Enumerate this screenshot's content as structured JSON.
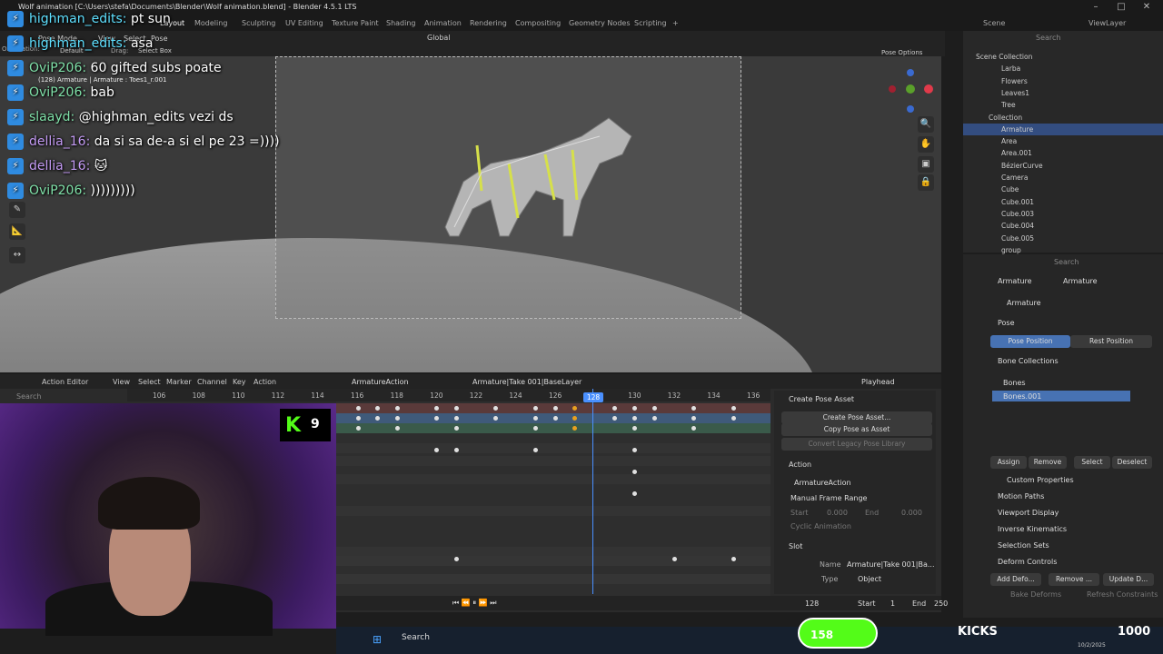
{
  "window": {
    "title": "Wolf animation [C:\\Users\\stefa\\Documents\\Blender\\Wolf animation.blend] - Blender 4.5.1 LTS"
  },
  "workspaces": [
    "Layout",
    "Modeling",
    "Sculpting",
    "UV Editing",
    "Texture Paint",
    "Shading",
    "Animation",
    "Rendering",
    "Compositing",
    "Geometry Nodes",
    "Scripting"
  ],
  "workspace_add": "+",
  "viewport": {
    "mode": "Pose Mode",
    "menus": [
      "View",
      "Select",
      "Pose"
    ],
    "orientation_label": "Orientation:",
    "orientation": "Default",
    "drag_label": "Drag:",
    "drag_value": "Select Box",
    "transform_orientation": "Global",
    "info_line": "(128) Armature | Armature : Toes1_r.001",
    "pose_options": "Pose Options",
    "ult_text": "ult"
  },
  "chat": [
    {
      "user": "highman_edits:",
      "msg": "pt sun",
      "color": "u"
    },
    {
      "user": "highman_edits:",
      "msg": "asa",
      "color": "u"
    },
    {
      "user": "OviP206:",
      "msg": "60 gifted subs poate",
      "color": "u3"
    },
    {
      "user": "OviP206:",
      "msg": "bab",
      "color": "u3"
    },
    {
      "user": "slaayd:",
      "msg": "@highman_edits vezi ds",
      "color": "u3"
    },
    {
      "user": "dellia_16:",
      "msg": "da si sa de-a si el pe 23 =))))",
      "color": "u2"
    },
    {
      "user": "dellia_16:",
      "msg": "🐱",
      "color": "u2"
    },
    {
      "user": "OviP206:",
      "msg": ")))))))))",
      "color": "u3"
    }
  ],
  "chat_badge_count": "1",
  "outliner": {
    "scene": "Scene",
    "view_layer": "ViewLayer",
    "search_placeholder": "Search",
    "rows": [
      {
        "name": "Scene Collection",
        "indent": 0,
        "sel": false
      },
      {
        "name": "Larba",
        "indent": 2,
        "sel": false
      },
      {
        "name": "Flowers",
        "indent": 2,
        "sel": false
      },
      {
        "name": "Leaves1",
        "indent": 2,
        "sel": false
      },
      {
        "name": "Tree",
        "indent": 2,
        "sel": false
      },
      {
        "name": "Collection",
        "indent": 1,
        "sel": false
      },
      {
        "name": "Armature",
        "indent": 2,
        "sel": true
      },
      {
        "name": "Area",
        "indent": 2,
        "sel": false
      },
      {
        "name": "Area.001",
        "indent": 2,
        "sel": false
      },
      {
        "name": "BézierCurve",
        "indent": 2,
        "sel": false
      },
      {
        "name": "Camera",
        "indent": 2,
        "sel": false
      },
      {
        "name": "Cube",
        "indent": 2,
        "sel": false
      },
      {
        "name": "Cube.001",
        "indent": 2,
        "sel": false
      },
      {
        "name": "Cube.003",
        "indent": 2,
        "sel": false
      },
      {
        "name": "Cube.004",
        "indent": 2,
        "sel": false
      },
      {
        "name": "Cube.005",
        "indent": 2,
        "sel": false
      },
      {
        "name": "group",
        "indent": 2,
        "sel": false
      }
    ]
  },
  "properties": {
    "search_placeholder": "Search",
    "breadcrumb": [
      "Armature",
      "Armature"
    ],
    "data_name": "Armature",
    "pose": "Pose",
    "pose_position": "Pose Position",
    "rest_position": "Rest Position",
    "bone_collections": "Bone Collections",
    "bones": [
      "Bones",
      "Bones.001"
    ],
    "assign": "Assign",
    "remove": "Remove",
    "select": "Select",
    "deselect": "Deselect",
    "custom_properties": "Custom Properties",
    "motion_paths": "Motion Paths",
    "viewport_display": "Viewport Display",
    "inverse_kinematics": "Inverse Kinematics",
    "selection_sets": "Selection Sets",
    "deform_controls": "Deform Controls",
    "add_deform": "Add Defo...",
    "remove_deform": "Remove ...",
    "update_deform": "Update D...",
    "bake_deforms": "Bake Deforms",
    "refresh_constraints": "Refresh Constraints"
  },
  "action_editor": {
    "mode": "Action Editor",
    "menus": [
      "View",
      "Select",
      "Marker",
      "Channel",
      "Key",
      "Action"
    ],
    "action": "ArmatureAction",
    "slot": "Armature|Take 001|BaseLayer",
    "playhead_label": "Playhead",
    "search_placeholder": "Search",
    "ruler_ticks": [
      "106",
      "108",
      "110",
      "112",
      "114",
      "116",
      "118",
      "120",
      "122",
      "124",
      "126",
      "128",
      "130",
      "132",
      "134",
      "136"
    ],
    "current_frame": "128",
    "side": {
      "create_pose_asset": "Create Pose Asset",
      "create_pose_asset_btn": "Create Pose Asset...",
      "copy_pose_as_asset": "Copy Pose as Asset",
      "convert_legacy": "Convert Legacy Pose Library",
      "action": "Action",
      "action_name": "ArmatureAction",
      "manual_frame_range": "Manual Frame Range",
      "start_label": "Start",
      "start_value": "0.000",
      "end_label": "End",
      "end_value": "0.000",
      "cyclic": "Cyclic Animation",
      "slot": "Slot",
      "name_label": "Name",
      "name_value": "Armature|Take 001|Ba...",
      "type_label": "Type",
      "type_value": "Object"
    }
  },
  "playback": {
    "frame": "128",
    "start_label": "Start",
    "start": "1",
    "end_label": "End",
    "end": "250"
  },
  "kick": {
    "count": "158",
    "kick_label": "KICKS",
    "kicks_value": "1000",
    "k_badge": "9"
  },
  "taskbar": {
    "search": "Search",
    "date": "10/2/2025"
  }
}
